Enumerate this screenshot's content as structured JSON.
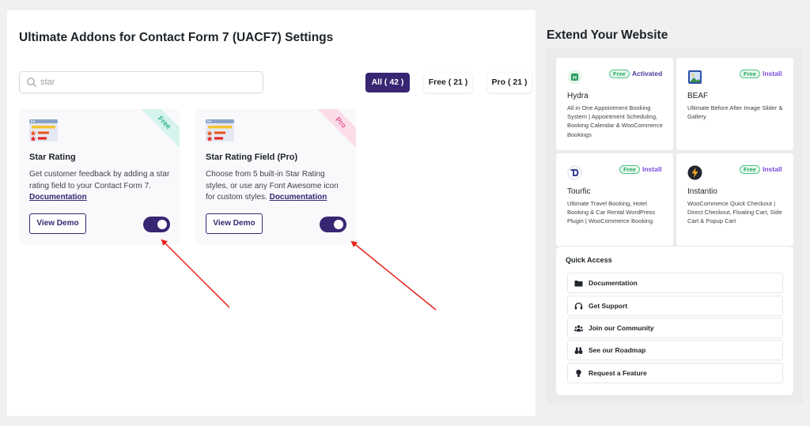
{
  "main": {
    "title": "Ultimate Addons for Contact Form 7 (UACF7) Settings",
    "search": {
      "value": "star",
      "placeholder": "Search"
    },
    "filters": [
      {
        "label": "All ( 42 )",
        "active": true
      },
      {
        "label": "Free ( 21 )",
        "active": false
      },
      {
        "label": "Pro ( 21 )",
        "active": false
      }
    ],
    "cards": [
      {
        "ribbon": "Free",
        "title": "Star Rating",
        "description": "Get customer feedback by adding a star rating field to your Contact Form 7.",
        "doc_link": "Documentation",
        "demo_label": "View Demo",
        "enabled": true
      },
      {
        "ribbon": "Pro",
        "title": "Star Rating Field (Pro)",
        "description": "Choose from 5 built-in Star Rating styles, or use any Font Awesome icon for custom styles.",
        "doc_link": "Documentation",
        "demo_label": "View Demo",
        "enabled": true
      }
    ]
  },
  "sidebar": {
    "title": "Extend Your Website",
    "extensions": [
      {
        "name": "Hydra",
        "badge": "Free",
        "status": "Activated",
        "description": "All in One Appointment Booking System | Appointment Scheduling, Booking Calendar & WooCommerce Bookings",
        "icon": "hydra-logo-icon"
      },
      {
        "name": "BEAF",
        "badge": "Free",
        "status": "Install",
        "description": "Ultimate Before After Image Slider & Gallery",
        "icon": "beaf-logo-icon"
      },
      {
        "name": "Tourfic",
        "badge": "Free",
        "status": "Install",
        "description": "Ultimate Travel Booking, Hotel Booking & Car Rental WordPress Plugin | WooCommerce Booking",
        "icon": "tourfic-logo-icon"
      },
      {
        "name": "Instantio",
        "badge": "Free",
        "status": "Install",
        "description": "WooCommerce Quick Checkout | Direct Checkout, Floating Cart, Side Cart & Popup Cart",
        "icon": "instantio-logo-icon"
      }
    ],
    "quick_access": {
      "title": "Quick Access",
      "items": [
        {
          "label": "Documentation",
          "icon": "folder-icon"
        },
        {
          "label": "Get Support",
          "icon": "headset-icon"
        },
        {
          "label": "Join our Community",
          "icon": "users-icon"
        },
        {
          "label": "See our Roadmap",
          "icon": "roadmap-icon"
        },
        {
          "label": "Request a Feature",
          "icon": "lightbulb-icon"
        }
      ]
    }
  },
  "colors": {
    "primary": "#382673",
    "free_badge": "#2aa865",
    "pro_ribbon": "#e8568e",
    "annotation_arrow": "#e8201a"
  }
}
